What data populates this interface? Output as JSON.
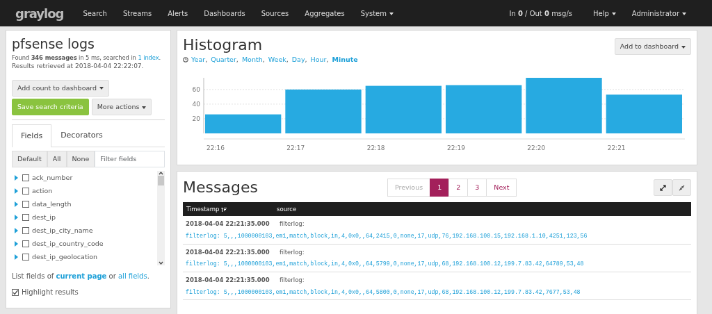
{
  "navbar": {
    "logo": "graylog",
    "links": [
      {
        "label": "Search",
        "dropdown": false
      },
      {
        "label": "Streams",
        "dropdown": false
      },
      {
        "label": "Alerts",
        "dropdown": false
      },
      {
        "label": "Dashboards",
        "dropdown": false
      },
      {
        "label": "Sources",
        "dropdown": false
      },
      {
        "label": "Aggregates",
        "dropdown": false
      },
      {
        "label": "System",
        "dropdown": true
      }
    ],
    "throughput": "In **0** / Out **0** msg/s",
    "right_menus": [
      "Help",
      "Administrator"
    ]
  },
  "sidebar": {
    "title": "pfsense logs",
    "summary_prefix": "Found **346 messages** in 5 ms, searched in",
    "summary_link": "1 index",
    "summary_suffix": ".",
    "retrieved": "Results retrieved at 2018-04-04 22:22:07.",
    "add_count_button": "Add count to dashboard",
    "save_button": "Save search criteria",
    "more_actions_button": "More actions",
    "tabs": [
      {
        "label": "Fields",
        "selected": true
      },
      {
        "label": "Decorators",
        "selected": false
      }
    ],
    "filter_buttons": [
      "Default",
      "All",
      "None"
    ],
    "filter": {
      "placeholder": "Filter fields"
    },
    "fields": [
      {
        "name": "ack_number",
        "checked": false
      },
      {
        "name": "action",
        "checked": false
      },
      {
        "name": "data_length",
        "checked": false
      },
      {
        "name": "dest_ip",
        "checked": false
      },
      {
        "name": "dest_ip_city_name",
        "checked": false
      },
      {
        "name": "dest_ip_country_code",
        "checked": false
      },
      {
        "name": "dest_ip_geolocation",
        "checked": false
      }
    ],
    "list_prefix": "List fields of",
    "list_link_1": "current page",
    "list_mid": "or",
    "list_link_2": "all fields",
    "list_suffix": ".",
    "highlight": {
      "label": "Highlight results",
      "checked": true
    }
  },
  "histogram": {
    "title": "Histogram",
    "add_button": "Add to dashboard",
    "resolutions": [
      {
        "label": "Year",
        "suffix": ",",
        "selected": false
      },
      {
        "label": "Quarter",
        "suffix": ",",
        "selected": false
      },
      {
        "label": "Month",
        "suffix": ",",
        "selected": false
      },
      {
        "label": "Week",
        "suffix": ",",
        "selected": false
      },
      {
        "label": "Day",
        "suffix": ",",
        "selected": false
      },
      {
        "label": "Hour",
        "suffix": ",",
        "selected": false
      },
      {
        "label": "Minute",
        "selected": true
      }
    ],
    "chart_data": {
      "type": "bar",
      "categories": [
        "22:16",
        "22:17",
        "22:18",
        "22:19",
        "22:20",
        "22:21"
      ],
      "series": [
        {
          "color": "#27aae1",
          "values": [
            26,
            60,
            65,
            66,
            76,
            53
          ]
        }
      ],
      "ylim": [
        0,
        76
      ],
      "yticks": [
        20,
        40,
        60
      ],
      "grid": true
    }
  },
  "messages": {
    "title": "Messages",
    "pagination": [
      {
        "label": "Previous",
        "disabled": true,
        "selected": false
      },
      {
        "label": "1",
        "disabled": false,
        "selected": true
      },
      {
        "label": "2",
        "disabled": false,
        "selected": false
      },
      {
        "label": "3",
        "disabled": false,
        "selected": false
      },
      {
        "label": "Next",
        "disabled": false,
        "selected": false
      }
    ],
    "columns": [
      "Timestamp",
      "source"
    ],
    "rows": [
      {
        "timestamp": "2018-04-04 22:21:35.000",
        "source": "filterlog:",
        "message": "filterlog: 5,,,1000000103,em1,match,block,in,4,0x0,,64,2415,0,none,17,udp,76,192.168.100.15,192.168.1.10,4251,123,56"
      },
      {
        "timestamp": "2018-04-04 22:21:35.000",
        "source": "filterlog:",
        "message": "filterlog: 5,,,1000000103,em1,match,block,in,4,0x0,,64,5799,0,none,17,udp,68,192.168.100.12,199.7.83.42,64789,53,48"
      },
      {
        "timestamp": "2018-04-04 22:21:35.000",
        "source": "filterlog:",
        "message": "filterlog: 5,,,1000000103,em1,match,block,in,4,0x0,,64,5800,0,none,17,udp,68,192.168.100.12,199.7.83.42,7677,53,48"
      }
    ]
  }
}
